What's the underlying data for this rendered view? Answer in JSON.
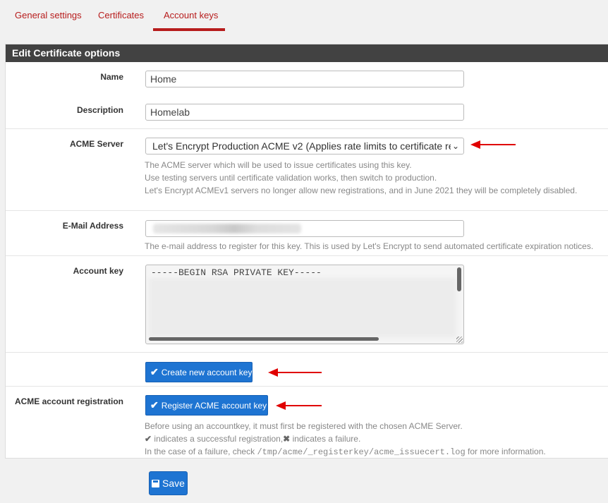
{
  "tabs": [
    {
      "label": "General settings"
    },
    {
      "label": "Certificates"
    },
    {
      "label": "Account keys"
    }
  ],
  "panel": {
    "title": "Edit Certificate options"
  },
  "form": {
    "name": {
      "label": "Name",
      "value": "Home"
    },
    "description": {
      "label": "Description",
      "value": "Homelab"
    },
    "acme_server": {
      "label": "ACME Server",
      "selected": "Let's Encrypt Production ACME v2 (Applies rate limits to certificate re",
      "help": [
        "The ACME server which will be used to issue certificates using this key.",
        "Use testing servers until certificate validation works, then switch to production.",
        "Let's Encrypt ACMEv1 servers no longer allow new registrations, and in June 2021 they will be completely disabled."
      ]
    },
    "email": {
      "label": "E-Mail Address",
      "help": "The e-mail address to register for this key. This is used by Let's Encrypt to send automated certificate expiration notices."
    },
    "account_key": {
      "label": "Account key",
      "first_line": "-----BEGIN RSA PRIVATE KEY-----"
    },
    "create_key": {
      "label": "Create new account key"
    },
    "registration": {
      "label": "ACME account registration",
      "button": "Register ACME account key",
      "help_line1": "Before using an accountkey, it must first be registered with the chosen ACME Server.",
      "help_success": "indicates a successful registration,",
      "help_failure": "indicates a failure.",
      "help_line3_pre": "In the case of a failure, check",
      "help_path": "/tmp/acme/_registerkey/acme_issuecert.log",
      "help_line3_post": "for more information."
    }
  },
  "save": {
    "label": "Save"
  },
  "colors": {
    "accent": "#b71c1c",
    "button": "#1e74d2",
    "header": "#424242",
    "arrow": "#e00000"
  }
}
